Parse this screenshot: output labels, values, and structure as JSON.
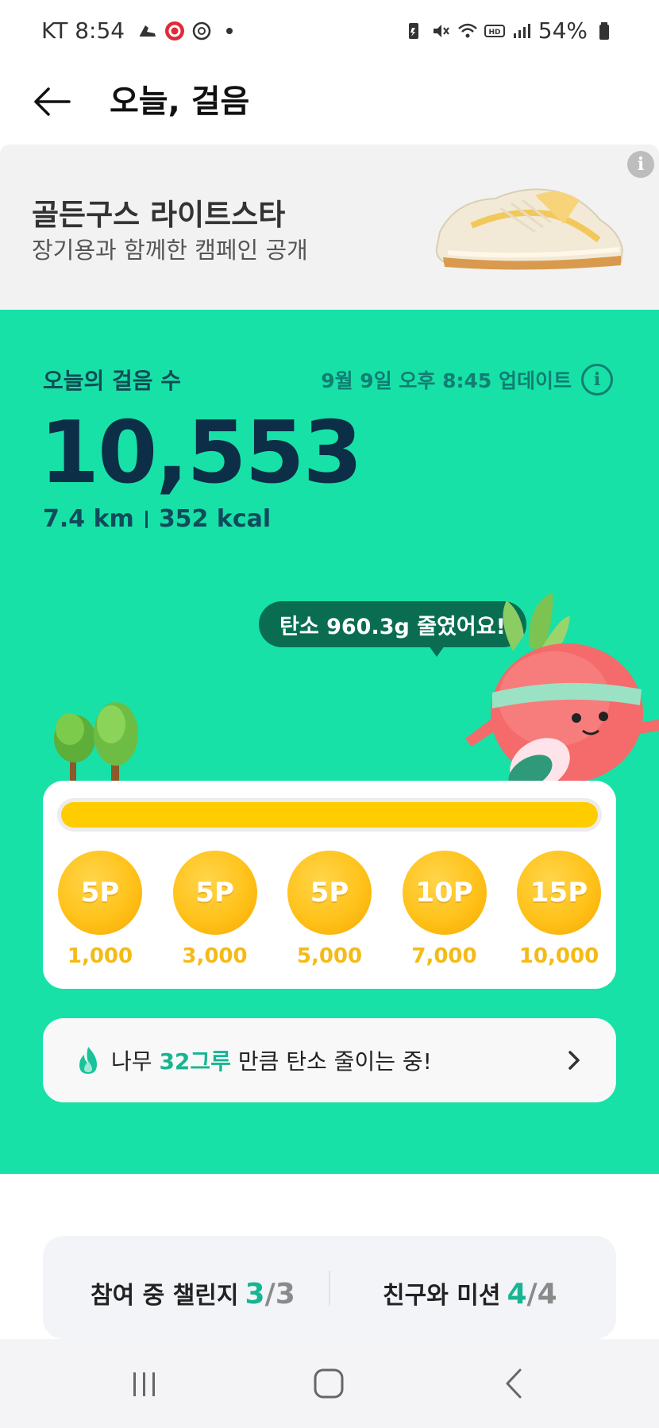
{
  "status_bar": {
    "carrier_time": "KT 8:54",
    "battery": "54%",
    "icons": [
      "shoe-notification-icon",
      "record-icon",
      "settings-notification-icon",
      "battery-saver-icon",
      "mute-icon",
      "wifi-icon",
      "hd-icon",
      "signal-icon",
      "battery-icon"
    ]
  },
  "header": {
    "title": "오늘, 걸음"
  },
  "banner": {
    "title": "골든구스 라이트스타",
    "subtitle": "장기용과 함께한 캠페인 공개"
  },
  "steps": {
    "label": "오늘의 걸음 수",
    "updated": "9월 9일 오후 8:45 업데이트",
    "count": "10,553",
    "distance": "7.4 km",
    "calories": "352 kcal"
  },
  "speech_bubble": "탄소 960.3g 줄였어요!",
  "progress": {
    "fraction": 1.0,
    "color": "#ffcc00",
    "rewards": [
      {
        "points": "5P",
        "steps": "1,000"
      },
      {
        "points": "5P",
        "steps": "3,000"
      },
      {
        "points": "5P",
        "steps": "5,000"
      },
      {
        "points": "10P",
        "steps": "7,000"
      },
      {
        "points": "15P",
        "steps": "10,000"
      }
    ]
  },
  "carbon": {
    "prefix": "나무",
    "highlight": "32그루",
    "suffix": "만큼 탄소 줄이는 중!"
  },
  "challenges": {
    "participating_label": "참여 중 챌린지",
    "participating_current": "3",
    "participating_total": "3",
    "friends_label": "친구와 미션",
    "friends_current": "4",
    "friends_total": "4"
  },
  "colors": {
    "accent_green": "#17e1a7",
    "dark_navy": "#0c2e47",
    "highlight_teal": "#17b592",
    "coin_gold": "#ffc21a"
  }
}
